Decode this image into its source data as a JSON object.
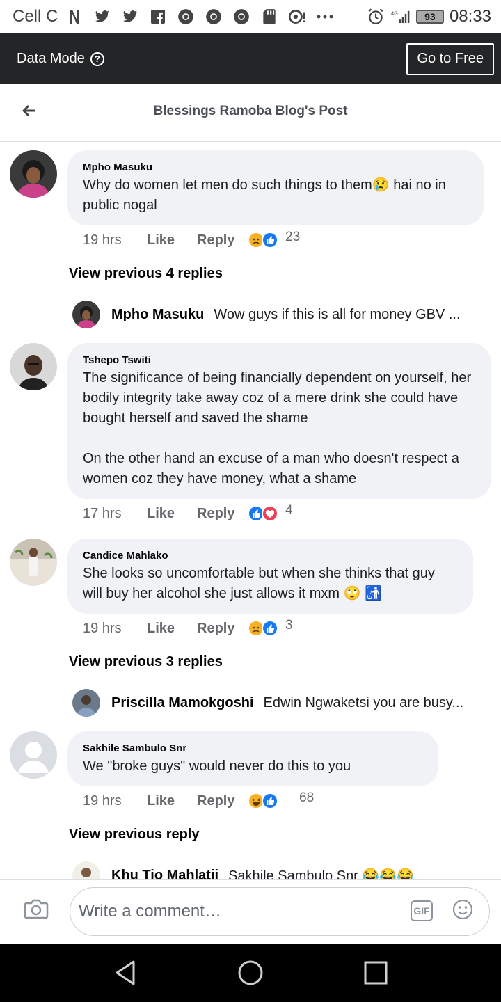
{
  "status_bar": {
    "carrier": "Cell C",
    "battery": "93",
    "time": "08:33",
    "network": "4G"
  },
  "data_bar": {
    "label": "Data Mode",
    "button": "Go to Free"
  },
  "header": {
    "title": "Blessings Ramoba Blog's Post"
  },
  "comments": [
    {
      "author": "Mpho Masuku",
      "text": "Why do women let men do such things to them😢 hai no in public nogal",
      "time": "19 hrs",
      "like": "Like",
      "reply": "Reply",
      "reactions": [
        "sad",
        "like"
      ],
      "count": "23",
      "view_previous": "View previous 4 replies",
      "reply_preview": {
        "name": "Mpho Masuku",
        "text": "Wow guys if this is all for money GBV ..."
      }
    },
    {
      "author": "Tshepo Tswiti",
      "text": "The significance of being financially dependent on yourself, her bodily integrity take away coz of a mere drink she could have bought herself and saved the shame\n\nOn the other hand an excuse of a man who doesn't respect a women coz they have money, what a shame",
      "time": "17 hrs",
      "like": "Like",
      "reply": "Reply",
      "reactions": [
        "like",
        "love"
      ],
      "count": "4"
    },
    {
      "author": "Candice Mahlako",
      "text": "She looks so uncomfortable but when she thinks that guy will buy her alcohol she just allows it mxm 🙄 🚮",
      "time": "19 hrs",
      "like": "Like",
      "reply": "Reply",
      "reactions": [
        "sad",
        "like"
      ],
      "count": "3",
      "view_previous": "View previous 3 replies",
      "reply_preview": {
        "name": "Priscilla Mamokgoshi",
        "text": "Edwin Ngwaketsi you are busy..."
      }
    },
    {
      "author": "Sakhile Sambulo Snr",
      "text": "We \"broke guys\" would never do this to you",
      "time": "19 hrs",
      "like": "Like",
      "reply": "Reply",
      "reactions": [
        "haha",
        "like"
      ],
      "count": "68",
      "view_previous": "View previous reply",
      "reply_preview": {
        "name": "Khu Tio Mahlatii",
        "text": "Sakhile Sambulo Snr 😂😂😂"
      }
    }
  ],
  "composer": {
    "placeholder": "Write a comment…",
    "gif": "GIF"
  },
  "colors": {
    "data_bar_bg": "#242526",
    "bubble_bg": "#f0f2f5",
    "like_blue": "#1877f2",
    "love_red": "#f33e58",
    "sad_yellow": "#f7b125"
  }
}
